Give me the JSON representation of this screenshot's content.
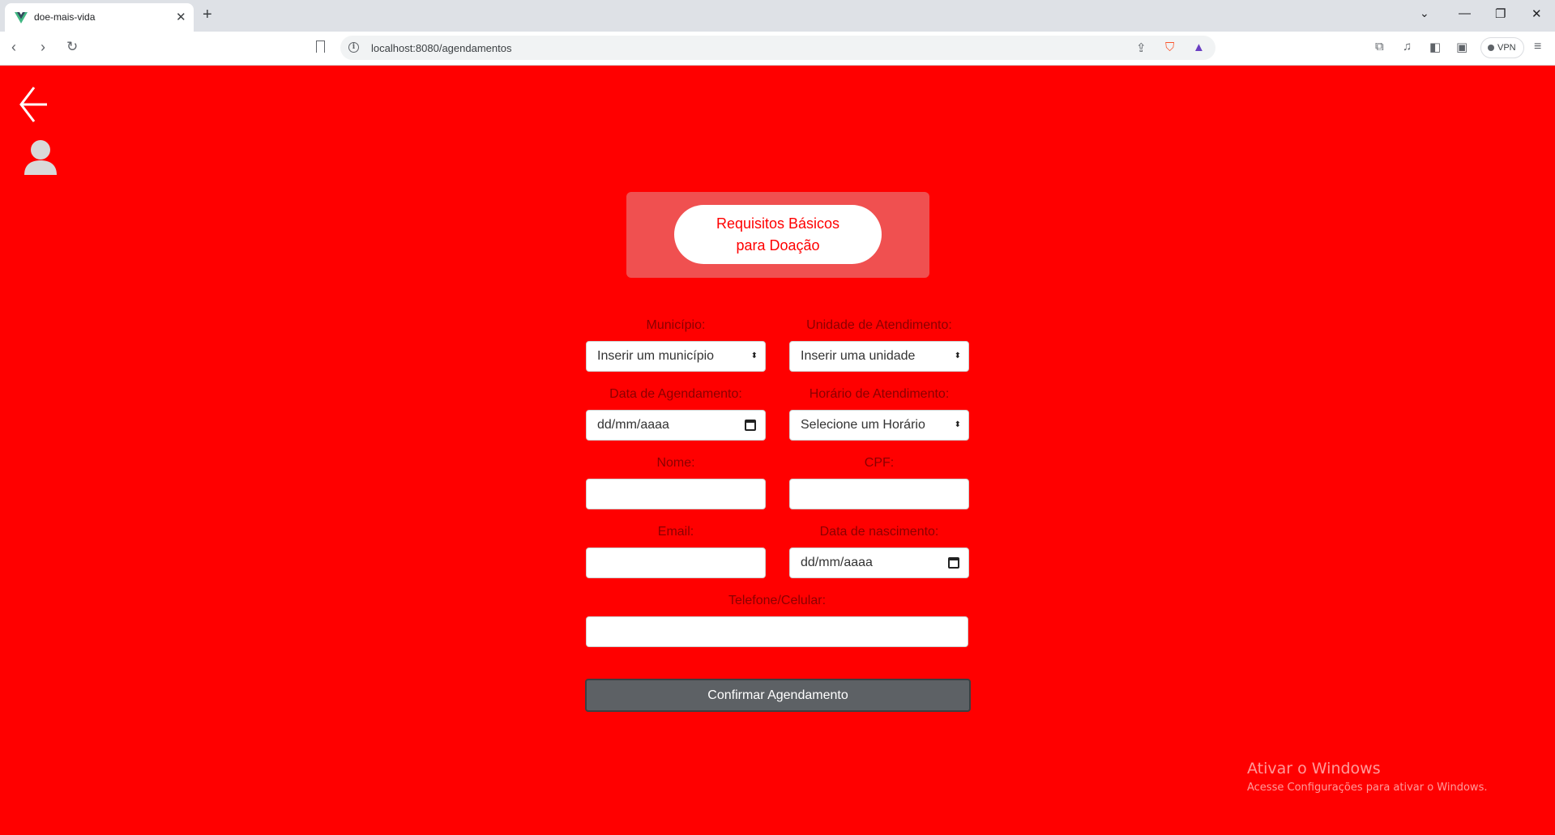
{
  "browser": {
    "tab_title": "doe-mais-vida",
    "url": "localhost:8080/agendamentos",
    "vpn_label": "VPN"
  },
  "page": {
    "requirements_line1": "Requisitos Básicos",
    "requirements_line2": "para Doação",
    "form": {
      "municipio_label": "Município:",
      "municipio_value": "Inserir um município",
      "unidade_label": "Unidade de Atendimento:",
      "unidade_value": "Inserir uma unidade",
      "data_agendamento_label": "Data de Agendamento:",
      "data_agendamento_value": "dd/mm/aaaa",
      "horario_label": "Horário de Atendimento:",
      "horario_value": "Selecione um Horário",
      "nome_label": "Nome:",
      "nome_value": "",
      "cpf_label": "CPF:",
      "cpf_value": "",
      "email_label": "Email:",
      "email_value": "",
      "nascimento_label": "Data de nascimento:",
      "nascimento_value": "dd/mm/aaaa",
      "telefone_label": "Telefone/Celular:",
      "telefone_value": "",
      "confirm_label": "Confirmar Agendamento"
    }
  },
  "watermark": {
    "title": "Ativar o Windows",
    "subtitle": "Acesse Configurações para ativar o Windows."
  },
  "colors": {
    "background": "#ff0000",
    "requirements_box": "#f05050",
    "confirm_button": "#5d6165"
  }
}
